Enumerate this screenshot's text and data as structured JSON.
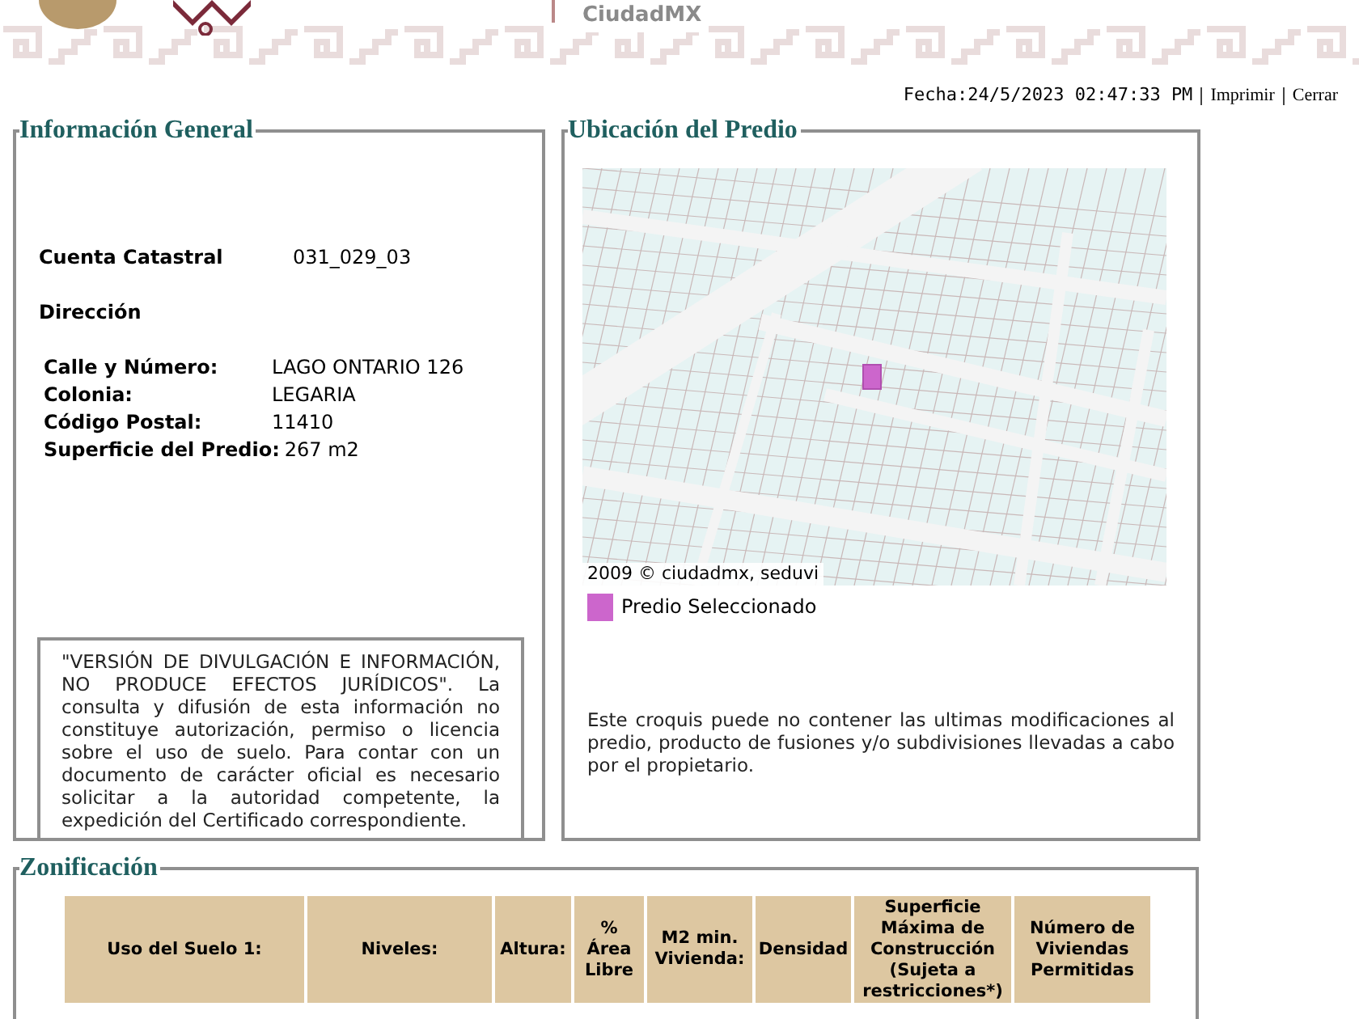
{
  "header": {
    "brand": "CiudadMX"
  },
  "top_bar": {
    "date": "Fecha:24/5/2023 02:47:33 PM",
    "links": [
      "Imprimir",
      "Cerrar"
    ]
  },
  "info_general": {
    "title": "Información General",
    "cuenta_catastral": {
      "label": "Cuenta Catastral",
      "value": "031_029_03"
    },
    "direccion_heading": "Dirección",
    "address_rows": [
      {
        "label": "Calle y Número:",
        "value": "LAGO ONTARIO 126"
      },
      {
        "label": "Colonia:",
        "value": "LEGARIA"
      },
      {
        "label": "Código Postal:",
        "value": "11410"
      },
      {
        "label": "Superficie del Predio:",
        "value": "267 m2"
      }
    ],
    "disclaimer": "\"VERSIÓN DE DIVULGACIÓN E INFORMACIÓN, NO PRODUCE EFECTOS JURÍDICOS\". La consulta y difusión de esta información no constituye autorización, permiso o licencia sobre el uso de suelo. Para contar con un documento de carácter oficial es necesario solicitar a la autoridad competente, la expedición del Certificado correspondiente."
  },
  "ubicacion": {
    "title": "Ubicación del Predio",
    "map_credit": "2009 © ciudadmx, seduvi",
    "legend_label": "Predio Seleccionado",
    "note": "Este croquis puede no contener las ultimas modificaciones al predio, producto de fusiones y/o subdivisiones llevadas a cabo por el propietario."
  },
  "zonificacion": {
    "title": "Zonificación",
    "columns": [
      "Uso del Suelo 1:",
      "Niveles:",
      "Altura:",
      "% Área Libre",
      "M2 min. Vivienda:",
      "Densidad",
      "Superficie Máxima de Construcción (Sujeta a restricciones*)",
      "Número de Viviendas Permitidas"
    ]
  }
}
